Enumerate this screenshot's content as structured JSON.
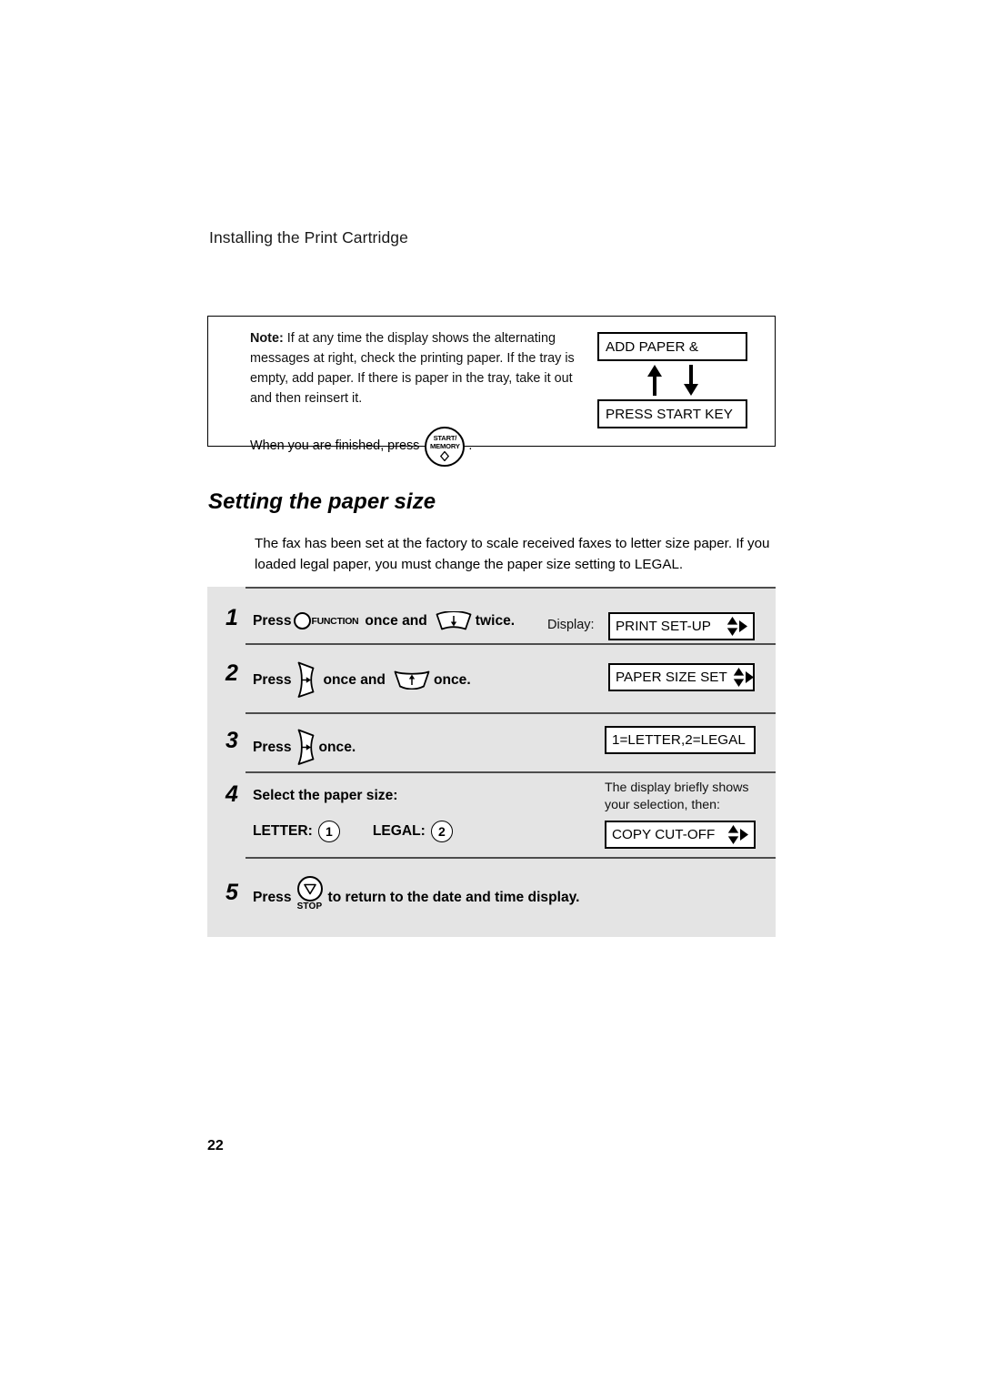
{
  "page": {
    "running_head": "Installing the Print Cartridge",
    "page_number": "22"
  },
  "note_box": {
    "label_note": "Note:",
    "body": "If at any time the display shows the alternating messages at right, check the printing paper. If the tray is empty, add paper. If there is paper in the tray, take it out and then reinsert it.",
    "finish_prefix": "When you are finished, press",
    "finish_suffix": ".",
    "start_key": {
      "line1": "START/",
      "line2": "MEMORY",
      "icon": "diamond-outline-icon"
    },
    "alternating_displays": {
      "first": "ADD PAPER &",
      "second": "PRESS START KEY",
      "arrow_up": "arrow-up-icon",
      "arrow_down": "arrow-down-icon"
    }
  },
  "section": {
    "heading": "Setting the paper size",
    "intro": "The fax has been set at the factory to scale received faxes to letter size paper. If you loaded legal paper, you must change the paper size setting to LEGAL."
  },
  "steps": [
    {
      "number": "1",
      "press_label": "Press",
      "function_key_label": "FUNCTION",
      "mid_text": "once and",
      "end_text": "twice.",
      "display_label": "Display:",
      "lcd": "PRINT SET-UP",
      "lcd_has_nav": true
    },
    {
      "number": "2",
      "press_label": "Press",
      "mid_text": "once and",
      "end_text": "once.",
      "lcd": "PAPER SIZE SET",
      "lcd_has_nav": true
    },
    {
      "number": "3",
      "press_label": "Press",
      "end_text": "once.",
      "lcd": "1=LETTER,2=LEGAL",
      "lcd_has_nav": false
    },
    {
      "number": "4",
      "title": "Select the paper size:",
      "letter_label": "LETTER:",
      "letter_key": "1",
      "legal_label": "LEGAL:",
      "legal_key": "2",
      "note_line1": "The display briefly shows",
      "note_line2": "your selection, then:",
      "lcd": "COPY CUT-OFF",
      "lcd_has_nav": true
    },
    {
      "number": "5",
      "press_label": "Press",
      "stop_key_label": "STOP",
      "end_text": "to return to the date and time display."
    }
  ],
  "colors": {
    "panel_background": "#e4e4e4",
    "divider": "#4d4d4d",
    "ink": "#000000",
    "paper": "#ffffff"
  }
}
